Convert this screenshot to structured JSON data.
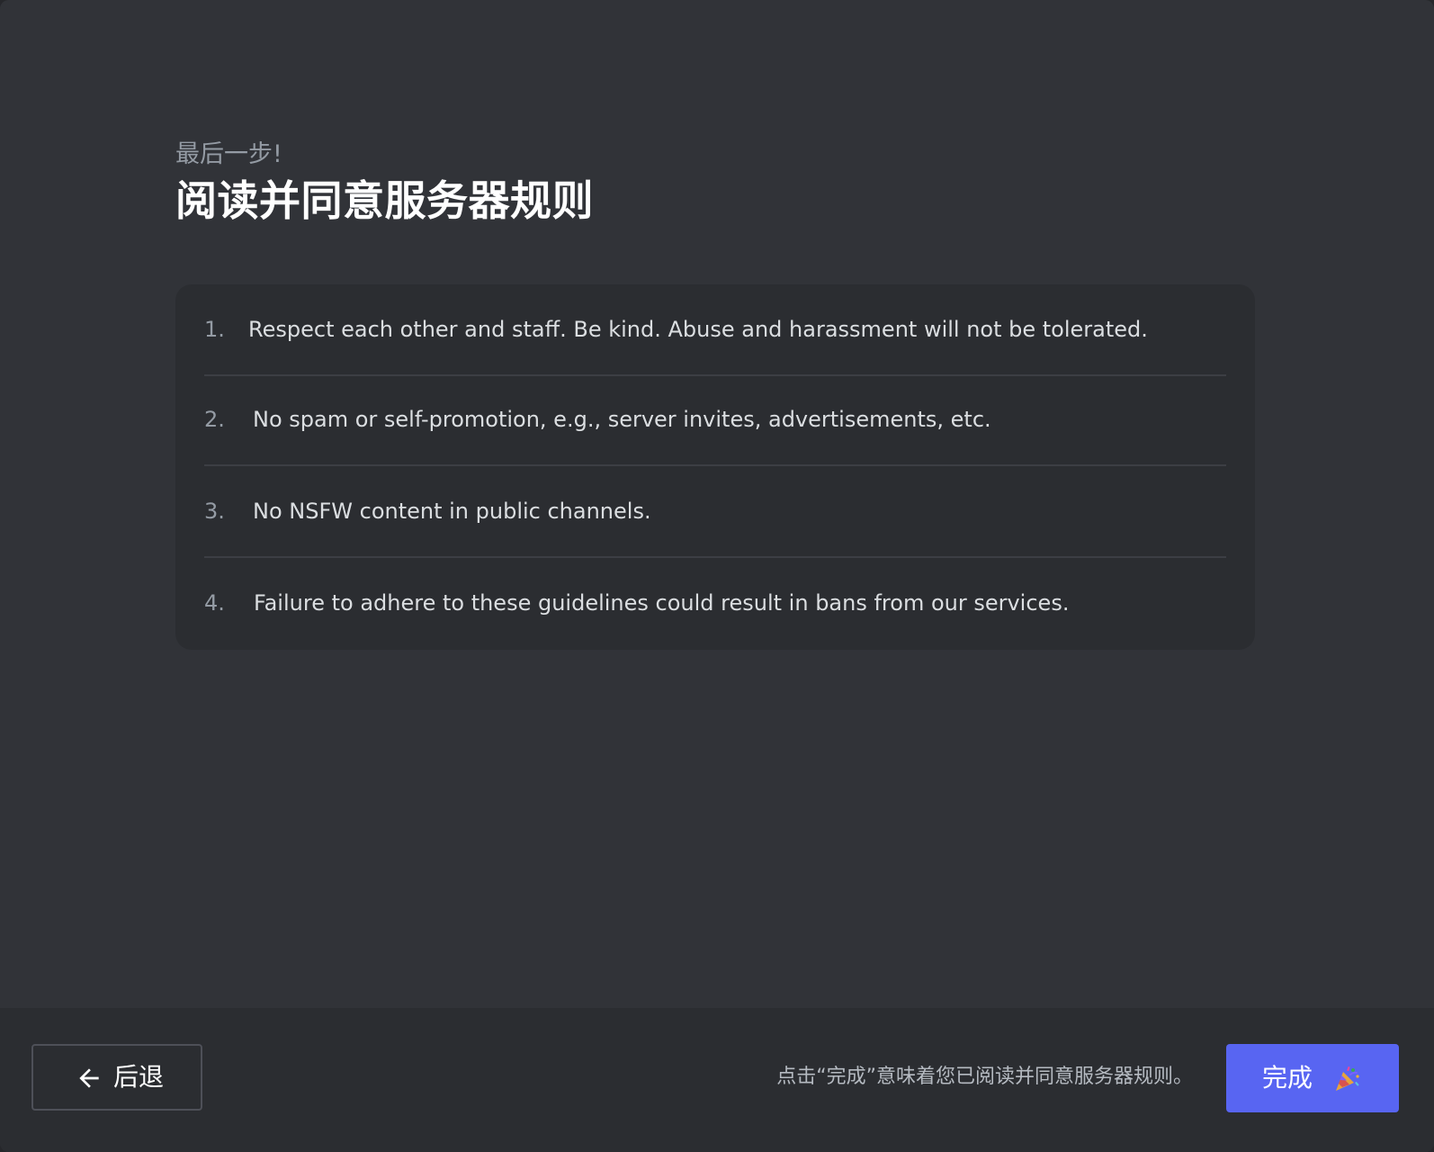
{
  "header": {
    "eyebrow": "最后一步!",
    "title": "阅读并同意服务器规则"
  },
  "rules": [
    {
      "number": "1.",
      "text": "Respect each other and staff. Be kind. Abuse and harassment will not be tolerated."
    },
    {
      "number": "2.",
      "text": "No spam or self-promotion, e.g., server invites, advertisements, etc."
    },
    {
      "number": "3.",
      "text": "No NSFW content in public channels."
    },
    {
      "number": "4.",
      "text": "Failure to adhere to these guidelines could result in bans from our services."
    }
  ],
  "footer": {
    "back_label": "后退",
    "back_icon": "arrow-left-icon",
    "agreement_note": "点击“完成”意味着您已阅读并同意服务器规则。",
    "finish_label": "完成",
    "finish_icon": "party-popper-icon"
  },
  "colors": {
    "accent": "#5865f2",
    "background": "#313338",
    "card": "#2b2d31"
  }
}
